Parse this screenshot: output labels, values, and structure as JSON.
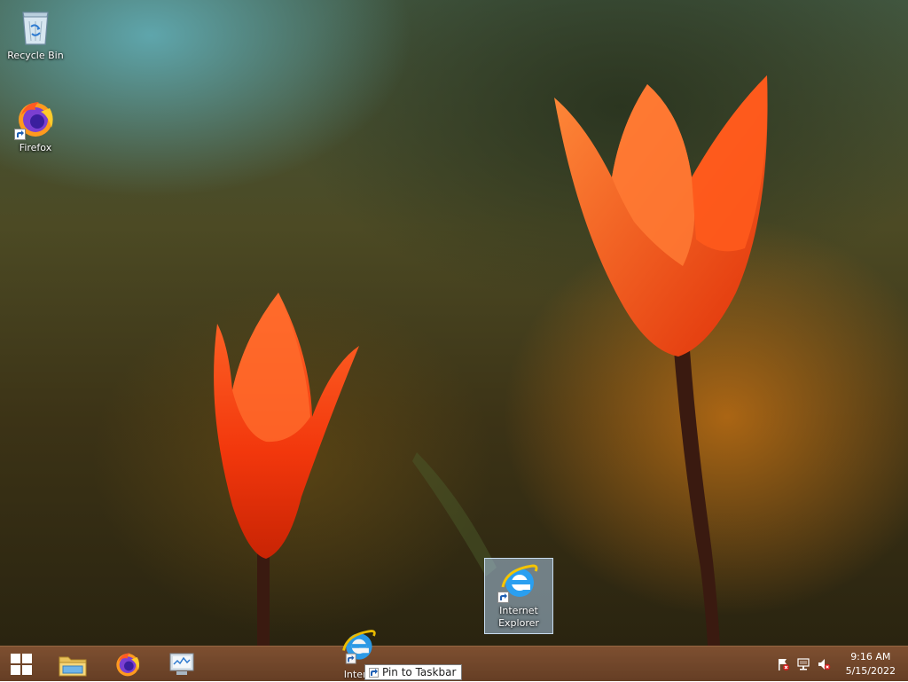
{
  "desktop": {
    "icons": [
      {
        "label": "Recycle Bin",
        "icon": "recycle-bin-icon"
      },
      {
        "label": "Firefox",
        "icon": "firefox-icon"
      },
      {
        "label": "Internet Explorer",
        "label_line1": "Internet",
        "label_line2": "Explorer",
        "icon": "internet-explorer-icon",
        "selected": true
      }
    ],
    "drag_ghost": {
      "label": "Intern",
      "icon": "internet-explorer-icon"
    }
  },
  "tooltip": {
    "text": "Pin to Taskbar",
    "icon": "pin-shortcut-icon"
  },
  "taskbar": {
    "start": {
      "icon": "windows-start-icon"
    },
    "pinned": [
      {
        "name": "File Explorer",
        "icon": "file-explorer-icon"
      },
      {
        "name": "Firefox",
        "icon": "firefox-icon"
      },
      {
        "name": "Task Manager",
        "icon": "task-manager-icon"
      }
    ],
    "tray": [
      {
        "icon": "action-center-flag-icon"
      },
      {
        "icon": "network-icon"
      },
      {
        "icon": "volume-muted-icon"
      }
    ],
    "clock": {
      "time": "9:16 AM",
      "date": "5/15/2022"
    }
  },
  "colors": {
    "taskbar": "#7a4828",
    "selection": "#aac8e6",
    "tulip": "#ff4a12"
  }
}
